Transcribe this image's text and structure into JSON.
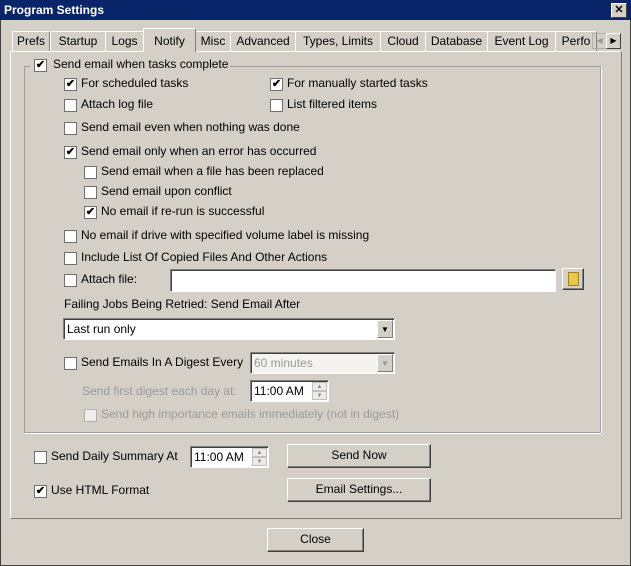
{
  "window": {
    "title": "Program Settings",
    "close": "✕"
  },
  "tabs": [
    "Prefs",
    "Startup",
    "Logs",
    "Notify",
    "Misc",
    "Advanced",
    "Types, Limits",
    "Cloud",
    "Database",
    "Event Log",
    "Perfo"
  ],
  "active_tab": "Notify",
  "group": {
    "label": "Send email when tasks complete",
    "checked": true
  },
  "options": {
    "scheduled": "For scheduled tasks",
    "manual": "For manually started tasks",
    "attach_log": "Attach log file",
    "list_filtered": "List filtered items",
    "nothing_done": "Send email even when nothing was done",
    "only_error": "Send email only when an error has occurred",
    "file_replaced": "Send email when a file has been replaced",
    "conflict": "Send email upon conflict",
    "rerun": "No email if re-run is successful",
    "volume_missing": "No email if drive with specified volume label is missing",
    "include_list": "Include List Of Copied Files And Other Actions",
    "attach_file": "Attach file:",
    "attach_file_value": ""
  },
  "retry": {
    "label": "Failing Jobs Being Retried: Send Email After",
    "value": "Last run only"
  },
  "digest": {
    "label": "Send Emails In A Digest Every",
    "interval": "60 minutes",
    "first_label": "Send first digest each day at:",
    "first_time": "11:00 AM",
    "high_importance": "Send high importance emails immediately (not in digest)"
  },
  "daily": {
    "label": "Send Daily Summary At",
    "time": "11:00 AM",
    "send_now": "Send Now"
  },
  "html": {
    "label": "Use HTML Format",
    "email_settings": "Email Settings..."
  },
  "close_button": "Close",
  "check": "✔"
}
